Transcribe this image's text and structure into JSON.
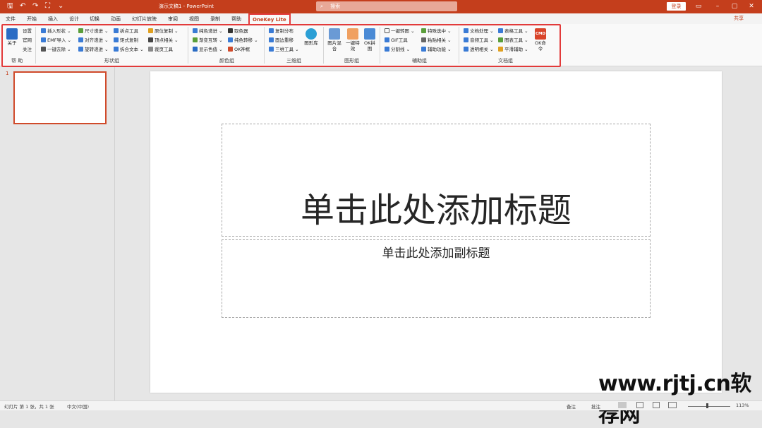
{
  "titlebar": {
    "doc_title": "演示文稿1 - PowerPoint",
    "search_placeholder": "搜索",
    "login": "登录",
    "qa": {
      "save": "🖫",
      "undo": "↶",
      "redo": "↷",
      "present": "⛶",
      "customize": "⌄"
    },
    "win": {
      "ribbon": "▭",
      "min": "–",
      "max": "▢",
      "close": "✕"
    }
  },
  "tabs": [
    "文件",
    "开始",
    "插入",
    "设计",
    "切换",
    "动画",
    "幻灯片放映",
    "审阅",
    "视图",
    "录制",
    "帮助",
    "OneKey Lite"
  ],
  "share": "共享",
  "ribbon": {
    "help_group": {
      "label": "帮 助",
      "about": "关于",
      "settings": "设置",
      "website": "官网",
      "follow": "关注"
    },
    "shape_group": {
      "label": "形状组",
      "cmds": [
        "插入形状",
        "尺寸递进",
        "拆点工具",
        "原位复制",
        "EMF导入",
        "对齐递进",
        "矩式复制",
        "顶点相关",
        "一键去除",
        "旋转递进",
        "拆合文本",
        "裁页工具"
      ]
    },
    "color_group": {
      "label": "颜色组",
      "cmds": [
        "纯色递进",
        "取色器",
        "渐变互转",
        "纯色转移",
        "显示色值",
        "OK神框"
      ]
    },
    "three_d_group": {
      "label": "三维组",
      "cmds": [
        "复制分布",
        "图形库",
        "面边重移",
        "三维工具"
      ]
    },
    "image_group": {
      "label": "图形组",
      "cmds": [
        "图片混合",
        "一键特效",
        "OK拼图"
      ]
    },
    "assist_group": {
      "label": "辅助组",
      "cmds": [
        "一键转图",
        "特殊选中",
        "GIF工具",
        "粘贴相关",
        "分割线",
        "辅助功能"
      ]
    },
    "doc_group": {
      "label": "文档组",
      "cmds": [
        "文档处理",
        "表格工具",
        "音频工具",
        "图表工具",
        "透明相关",
        "平滑辅助",
        "OK命令"
      ],
      "cmd_badge": "CMD"
    }
  },
  "thumbs": {
    "num": "1"
  },
  "slide": {
    "title_ph": "单击此处添加标题",
    "subtitle_ph": "单击此处添加副标题"
  },
  "watermark": "www.rjtj.cn软荐网",
  "status": {
    "slide_info": "幻灯片 第 1 张，共 1 张",
    "lang": "中文(中国)",
    "notes": "备注",
    "comments": "批注",
    "zoom": "113%"
  },
  "colors": {
    "accent": "#c43e1c",
    "highlight": "#e23a3a"
  }
}
